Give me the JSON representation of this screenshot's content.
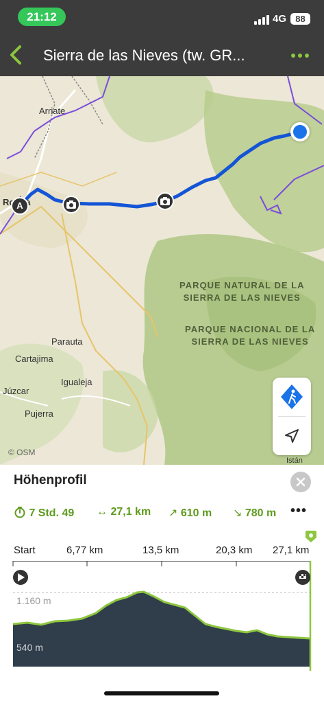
{
  "status_bar": {
    "time": "21:12",
    "network": "4G",
    "battery": "88"
  },
  "header": {
    "title": "Sierra de las Nieves (tw. GR...",
    "menu_icon": "more-dots-icon",
    "back_icon": "back-chevron-icon"
  },
  "map": {
    "places": [
      "Arriate",
      "Ronda",
      "Parauta",
      "Cartajima",
      "Igualeja",
      "Júzcar",
      "Pujerra",
      "Istán"
    ],
    "park_labels": [
      {
        "line1": "PARQUE NATURAL DE LA",
        "line2": "SIERRA DE LAS NIEVES"
      },
      {
        "line1": "PARQUE NACIONAL DE LA",
        "line2": "SIERRA DE LAS NIEVES"
      }
    ],
    "attribution": "© OSM",
    "start_marker": "A",
    "colors": {
      "route": "#1455d6",
      "boundary": "#7a4ddc",
      "forest": "#bccf96"
    }
  },
  "profile": {
    "title": "Höhenprofil",
    "duration": "7 Std. 49",
    "distance": "27,1 km",
    "ascent": "610 m",
    "descent": "780 m",
    "distance_ticks": [
      "Start",
      "6,77 km",
      "13,5 km",
      "20,3 km",
      "27,1 km"
    ],
    "elevation_high": "1.160 m",
    "elevation_low": "540 m",
    "accent": "#8dc63f"
  }
}
